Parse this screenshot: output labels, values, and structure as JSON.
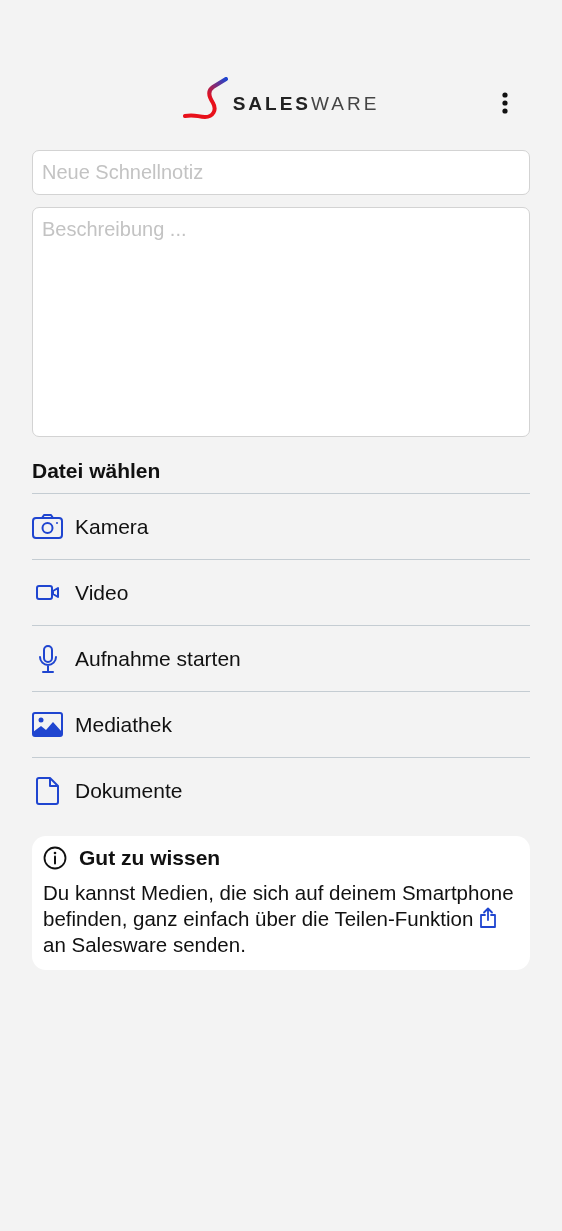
{
  "header": {
    "logo": {
      "strong": "SALES",
      "light": "WARE"
    }
  },
  "form": {
    "title_placeholder": "Neue Schnellnotiz",
    "description_placeholder": "Beschreibung ..."
  },
  "file_section": {
    "title": "Datei wählen",
    "items": [
      {
        "kind": "camera",
        "label": "Kamera"
      },
      {
        "kind": "video",
        "label": "Video"
      },
      {
        "kind": "microphone",
        "label": "Aufnahme starten"
      },
      {
        "kind": "image",
        "label": "Mediathek"
      },
      {
        "kind": "document",
        "label": "Dokumente"
      }
    ]
  },
  "info": {
    "title": "Gut zu wissen",
    "text_before": "Du kannst Medien, die sich auf deinem Smartphone befinden, ganz einfach über die Teilen-Funktion",
    "text_after": "an Salesware senden."
  }
}
